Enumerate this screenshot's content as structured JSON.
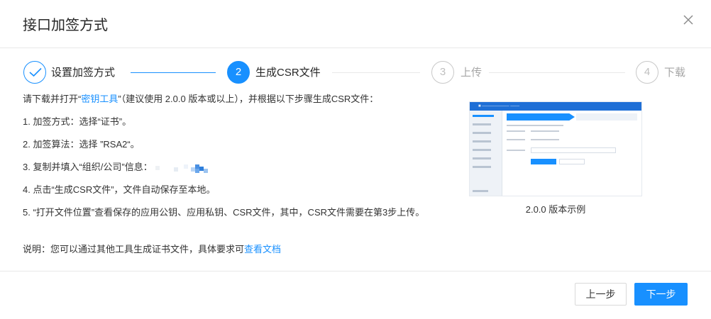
{
  "dialog": {
    "title": "接口加签方式"
  },
  "steps": [
    {
      "number": "1",
      "label": "设置加签方式",
      "status": "done"
    },
    {
      "number": "2",
      "label": "生成CSR文件",
      "status": "active"
    },
    {
      "number": "3",
      "label": "上传",
      "status": "wait"
    },
    {
      "number": "4",
      "label": "下载",
      "status": "wait"
    }
  ],
  "content": {
    "intro_prefix": "请下载并打开“",
    "intro_link": "密钥工具",
    "intro_suffix": "”（建议使用 2.0.0 版本或以上），并根据以下步骤生成CSR文件：",
    "step1": "1. 加签方式：选择“证书”。",
    "step2": "2. 加签算法：选择 ”RSA2“。",
    "step3": "3. 复制并填入“组织/公司”信息：",
    "step4": "4. 点击“生成CSR文件”，文件自动保存至本地。",
    "step5": "5. “打开文件位置”查看保存的应用公钥、应用私钥、CSR文件，其中，CSR文件需要在第3步上传。",
    "note_prefix": "说明：您可以通过其他工具生成证书文件，具体要求可",
    "note_link": "查看文档"
  },
  "preview": {
    "caption": "2.0.0 版本示例"
  },
  "footer": {
    "prev_label": "上一步",
    "next_label": "下一步"
  },
  "colors": {
    "primary": "#1890ff",
    "border": "#d9d9d9"
  }
}
